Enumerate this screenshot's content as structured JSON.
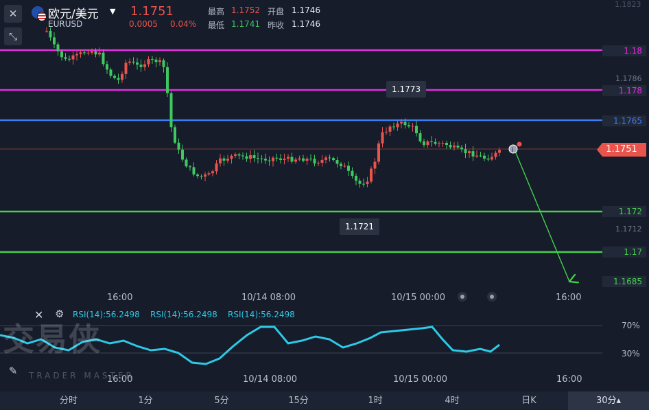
{
  "header": {
    "symbol_cn": "欧元/美元",
    "symbol_code": "EURUSD",
    "price": "1.1751",
    "change": "0.0005",
    "change_pct": "0.04%",
    "high_label": "最高",
    "high_value": "1.1752",
    "low_label": "最低",
    "low_value": "1.1741",
    "open_label": "开盘",
    "open_value": "1.1746",
    "prev_close_label": "昨收",
    "prev_close_value": "1.1746",
    "flag_icon": "eu-us-flag-icon",
    "dropdown_icon": "caret-down-icon"
  },
  "toolbar": {
    "close_icon": "close-icon",
    "collapse_icon": "collapse-arrows-icon",
    "draw_icon": "pencil-icon",
    "indicator_icon": "indicator-icon"
  },
  "price_axis": {
    "ticks": [
      "1.1786",
      "1.1712"
    ],
    "top_clipped": "1.1823"
  },
  "levels": [
    {
      "label": "1.18",
      "color": "#e62de0"
    },
    {
      "label": "1.178",
      "color": "#e62de0"
    },
    {
      "label": "1.1765",
      "color": "#3b7cf0"
    },
    {
      "label": "1.172",
      "color": "#44d24c"
    },
    {
      "label": "1.17",
      "color": "#44d24c"
    }
  ],
  "current_price_tag": "1.1751",
  "projection_target": "1.1685",
  "callouts": {
    "high": "1.1773",
    "low": "1.1721"
  },
  "time_axis": [
    "16:00",
    "10/14 08:00",
    "10/15 00:00",
    "16:00"
  ],
  "rsi": {
    "labels": [
      "RSI(14):56.2498",
      "RSI(14):56.2498",
      "RSI(14):56.2498"
    ],
    "upper": "70%",
    "lower": "30%",
    "time_axis": [
      "16:00",
      "10/14 08:00",
      "10/15 00:00",
      "16:00"
    ]
  },
  "watermark": {
    "cn": "交易侠",
    "en": "TRADER MASTER"
  },
  "timeframes": [
    "分时",
    "1分",
    "5分",
    "15分",
    "1时",
    "4时",
    "日K",
    "30分▴"
  ],
  "active_timeframe": "30分▴",
  "colors": {
    "up": "#e9544d",
    "down": "#3fc860",
    "bg": "#161c2a",
    "rsi": "#2ec9e6"
  }
}
